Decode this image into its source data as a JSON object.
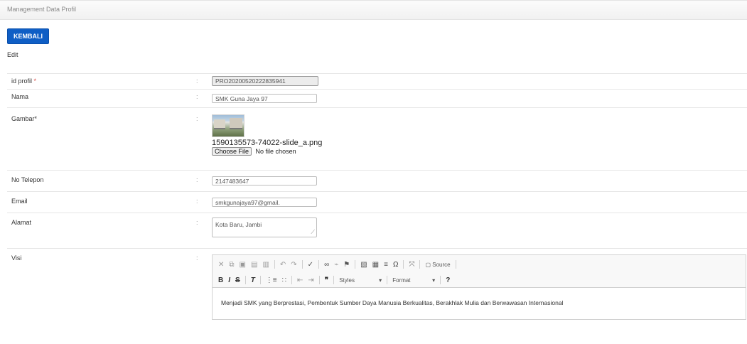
{
  "header": {
    "title": "Management Data Profil"
  },
  "toolbar": {
    "back_label": "KEMBALI"
  },
  "section": {
    "title": "Edit"
  },
  "colon": ":",
  "fields": {
    "id_profil": {
      "label": "id profil",
      "required_mark": "*",
      "value": "PRO20200520222835941"
    },
    "nama": {
      "label": "Nama",
      "value": "SMK Guna Jaya 97"
    },
    "gambar": {
      "label": "Gambar*",
      "filename": "1590135573-74022-slide_a.png",
      "choose_label": "Choose File",
      "no_file": "No file chosen"
    },
    "telepon": {
      "label": "No Telepon",
      "value": "2147483647"
    },
    "email": {
      "label": "Email",
      "value": "smkgunajaya97@gmail."
    },
    "alamat": {
      "label": "Alamat",
      "value": "Kota Baru, Jambi"
    },
    "visi": {
      "label": "Visi",
      "content": "Menjadi SMK yang Berprestasi, Pembentuk Sumber Daya Manusia Berkualitas, Berakhlak Mulia dan Berwawasan Internasional"
    }
  },
  "editor_toolbar": {
    "row1_icons": [
      "cut-icon",
      "copy-icon",
      "paste-icon",
      "paste-text-icon",
      "paste-word-icon",
      "undo-icon",
      "redo-icon",
      "spellcheck-icon",
      "link-icon",
      "unlink-icon",
      "anchor-icon",
      "image-icon",
      "table-icon",
      "hr-icon",
      "special-char-icon",
      "maximize-icon"
    ],
    "source_label": "Source",
    "bold": "B",
    "italic": "I",
    "strike": "S",
    "styles_label": "Styles",
    "format_label": "Format",
    "help": "?"
  }
}
